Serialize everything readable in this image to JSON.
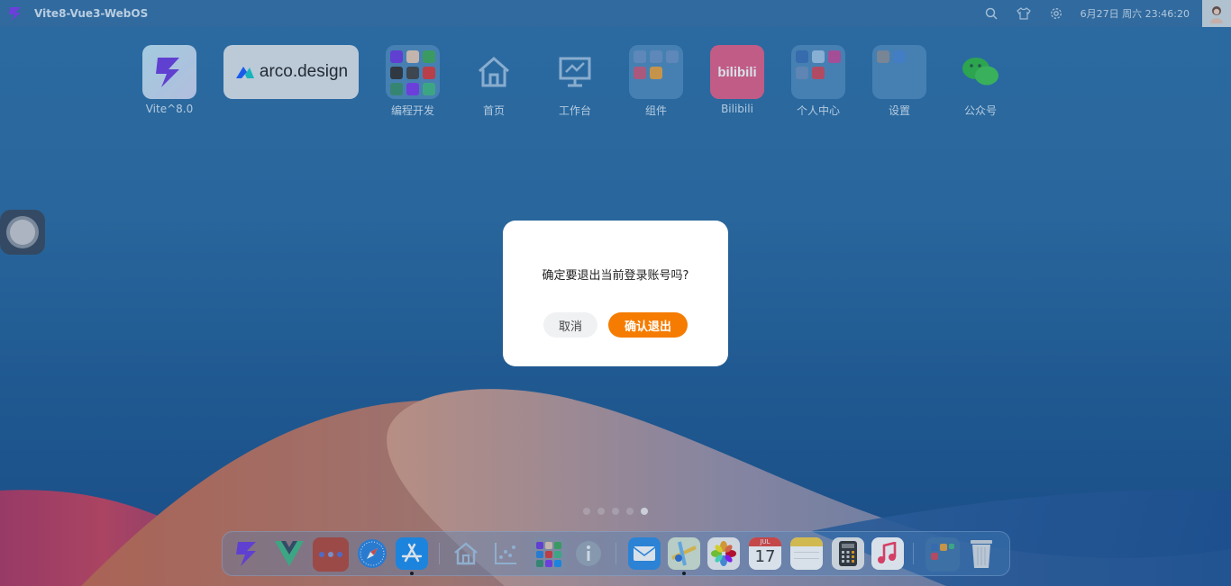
{
  "topbar": {
    "title": "Vite8-Vue3-WebOS",
    "clock": "6月27日 周六 23:46:20",
    "icons": [
      "search-icon",
      "shirt-icon",
      "gear-icon"
    ]
  },
  "desktop": {
    "icons": [
      {
        "label": "Vite^8.0",
        "icon": "vite-logo"
      },
      {
        "label": "",
        "icon": "arco-design-logo",
        "text": "arco.design"
      },
      {
        "label": "编程开发",
        "icon": "folder"
      },
      {
        "label": "首页",
        "icon": "home-icon"
      },
      {
        "label": "工作台",
        "icon": "presentation-icon"
      },
      {
        "label": "组件",
        "icon": "folder"
      },
      {
        "label": "Bilibili",
        "icon": "bilibili-logo",
        "text": "bilibili"
      },
      {
        "label": "个人中心",
        "icon": "folder"
      },
      {
        "label": "设置",
        "icon": "folder"
      },
      {
        "label": "公众号",
        "icon": "wechat-icon"
      }
    ]
  },
  "pager": {
    "count": 5,
    "active": 5
  },
  "dock": {
    "items": [
      "vite",
      "vue",
      "folder",
      "safari",
      "app-store",
      "home",
      "chart",
      "folder-apps",
      "info",
      "mail",
      "maps",
      "photos",
      "calendar",
      "notes",
      "calculator",
      "music",
      "folder-widgets",
      "trash"
    ],
    "calendar": {
      "month": "JUL",
      "day": "17"
    }
  },
  "dialog": {
    "message": "确定要退出当前登录账号吗?",
    "cancel_label": "取消",
    "confirm_label": "确认退出"
  },
  "colors": {
    "accent": "#f57c00"
  }
}
